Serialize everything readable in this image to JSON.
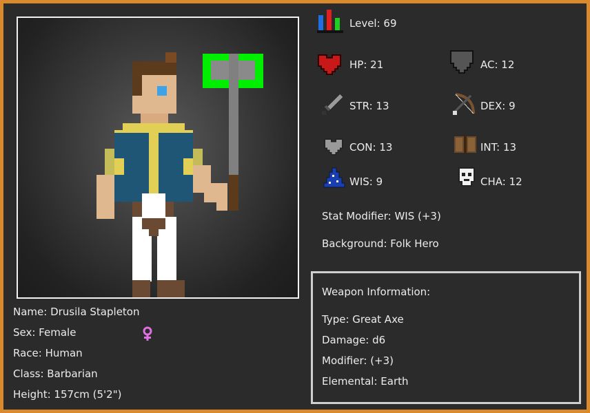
{
  "character": {
    "name": "Name: Drusila Stapleton",
    "sex": "Sex: Female",
    "race": "Race: Human",
    "class": "Class: Barbarian",
    "height": "Height: 157cm (5'2\")"
  },
  "stats": {
    "level": "Level: 69",
    "hp": "HP: 21",
    "ac": "AC: 12",
    "str": "STR: 13",
    "dex": "DEX: 9",
    "con": "CON: 13",
    "int": "INT: 13",
    "wis": "WIS: 9",
    "cha": "CHA: 12",
    "modifier": "Stat Modifier: WIS (+3)",
    "background": "Background: Folk Hero"
  },
  "weapon": {
    "heading": "Weapon Information:",
    "type": "Type: Great Axe",
    "damage": "Damage: d6",
    "modifier": "Modifier: (+3)",
    "elemental": "Elemental: Earth"
  },
  "icons": {
    "level": "level-bars-icon",
    "hp": "heart-icon",
    "ac": "shield-icon",
    "str": "sword-icon",
    "dex": "bow-icon",
    "con": "grey-heart-icon",
    "int": "book-icon",
    "wis": "wizard-hat-icon",
    "cha": "mask-icon",
    "sex": "female-symbol-icon"
  },
  "colors": {
    "border": "#d98a2c",
    "background": "#2b2b2b",
    "text": "#ececec",
    "axe_glow": "#00ee00",
    "female_symbol": "#e070e0"
  }
}
